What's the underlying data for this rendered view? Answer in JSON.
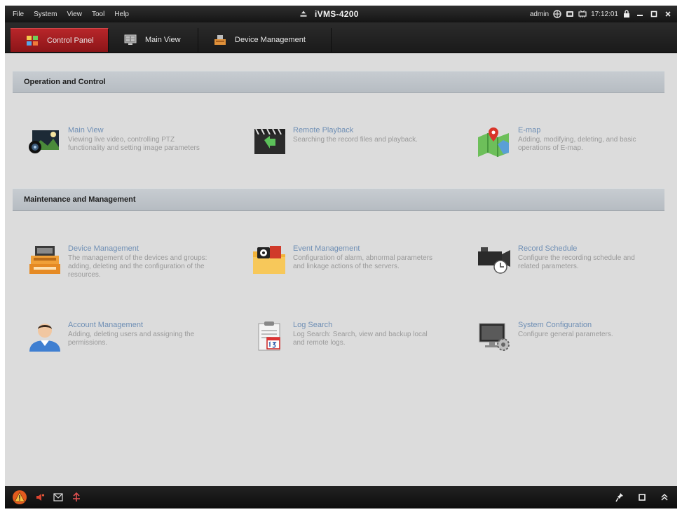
{
  "menu": {
    "items": [
      "File",
      "System",
      "View",
      "Tool",
      "Help"
    ]
  },
  "app": {
    "title": "iVMS-4200"
  },
  "titlebar": {
    "user": "admin",
    "time": "17:12:01"
  },
  "tabs": [
    {
      "label": "Control Panel",
      "icon": "grid-icon",
      "active": true
    },
    {
      "label": "Main View",
      "icon": "monitor-icon",
      "active": false
    },
    {
      "label": "Device Management",
      "icon": "device-icon",
      "active": false
    }
  ],
  "sections": {
    "operation": {
      "title": "Operation and Control",
      "cards": [
        {
          "title": "Main View",
          "desc": "Viewing live video, controlling PTZ functionality and setting image parameters",
          "icon": "camera-view-icon"
        },
        {
          "title": "Remote Playback",
          "desc": "Searching the record files and playback.",
          "icon": "playback-icon"
        },
        {
          "title": "E-map",
          "desc": "Adding, modifying, deleting, and basic operations of E-map.",
          "icon": "map-icon"
        }
      ]
    },
    "maintenance": {
      "title": "Maintenance and Management",
      "cards": [
        {
          "title": "Device Management",
          "desc": "The management of the devices and groups: adding, deleting and the configuration of the resources.",
          "icon": "device-management-icon"
        },
        {
          "title": "Event Management",
          "desc": "Configuration of alarm, abnormal parameters and linkage actions of the servers.",
          "icon": "event-folder-icon"
        },
        {
          "title": "Record Schedule",
          "desc": "Configure the recording schedule and related parameters.",
          "icon": "video-camera-clock-icon"
        },
        {
          "title": "Account Management",
          "desc": "Adding, deleting users and assigning the permissions.",
          "icon": "user-account-icon"
        },
        {
          "title": "Log Search",
          "desc": "Log Search: Search, view and backup local and remote logs.",
          "icon": "calendar-log-icon"
        },
        {
          "title": "System Configuration",
          "desc": "Configure general parameters.",
          "icon": "system-config-icon"
        }
      ]
    }
  },
  "colors": {
    "accent": "#a81e22",
    "link": "#6f8fb5",
    "header_bg": "#bfc4c9"
  }
}
